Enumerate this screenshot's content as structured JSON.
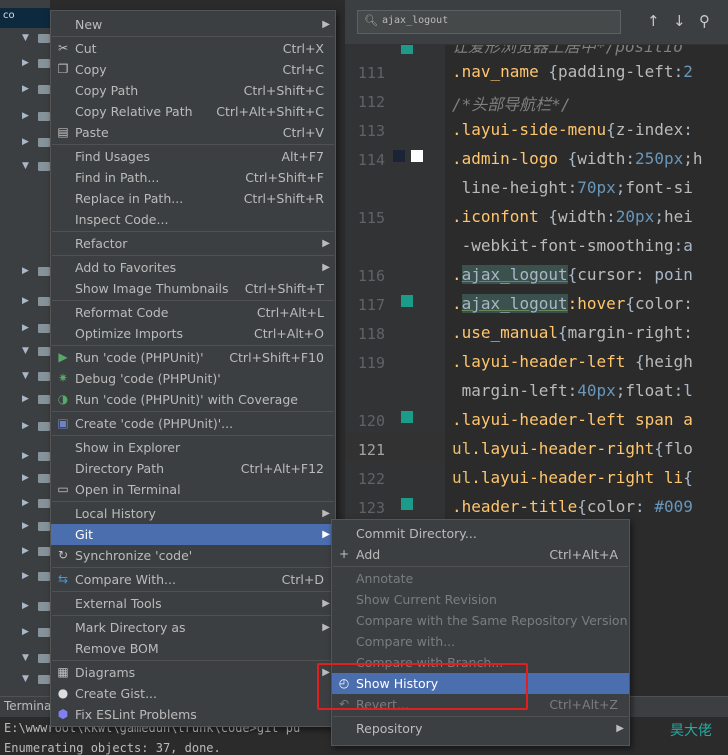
{
  "tree": {
    "root_label": "co"
  },
  "editor": {
    "search": {
      "query": "ajax_logout"
    },
    "lines": [
      {
        "num": "",
        "parts": [
          [
            "cmt",
            "让爱形浏览器上居中*/positio"
          ]
        ]
      },
      {
        "num": "111",
        "parts": [
          [
            "sel",
            ".nav_name"
          ],
          [
            "",
            " {"
          ],
          [
            "prop",
            "padding-left"
          ],
          [
            "",
            ":"
          ],
          [
            "num",
            "2"
          ]
        ]
      },
      {
        "num": "112",
        "parts": [
          [
            "cmt",
            "/*头部导航栏*/"
          ]
        ]
      },
      {
        "num": "113",
        "parts": [
          [
            "sel",
            ".layui-side-menu"
          ],
          [
            "",
            "{"
          ],
          [
            "prop",
            "z-index"
          ],
          [
            "",
            ":"
          ]
        ]
      },
      {
        "num": "114",
        "parts": [
          [
            "sel",
            ".admin-logo"
          ],
          [
            "",
            " {"
          ],
          [
            "prop",
            "width"
          ],
          [
            "",
            ":"
          ],
          [
            "num",
            "250px"
          ],
          [
            "",
            ";"
          ],
          [
            "prop",
            "h"
          ]
        ]
      },
      {
        "num": "",
        "parts": [
          [
            "prop",
            " line-height"
          ],
          [
            "",
            ":"
          ],
          [
            "num",
            "70px"
          ],
          [
            "",
            ";"
          ],
          [
            "prop",
            "font-si"
          ]
        ]
      },
      {
        "num": "115",
        "parts": [
          [
            "sel",
            ".iconfont"
          ],
          [
            "",
            " {"
          ],
          [
            "prop",
            "width"
          ],
          [
            "",
            ":"
          ],
          [
            "num",
            "20px"
          ],
          [
            "",
            ";"
          ],
          [
            "prop",
            "hei"
          ]
        ]
      },
      {
        "num": "",
        "parts": [
          [
            "prop",
            " -webkit-font-smoothing"
          ],
          [
            "",
            ":a"
          ]
        ]
      },
      {
        "num": "116",
        "parts": [
          [
            "sel",
            "."
          ],
          [
            "hl",
            "ajax_logout"
          ],
          [
            "",
            "{"
          ],
          [
            "prop",
            "cursor"
          ],
          [
            "",
            ": poin"
          ]
        ]
      },
      {
        "num": "117",
        "parts": [
          [
            "sel",
            "."
          ],
          [
            "hl",
            "ajax_logout"
          ],
          [
            "sel",
            ":hover"
          ],
          [
            "",
            "{"
          ],
          [
            "prop",
            "color"
          ],
          [
            "",
            ":"
          ]
        ]
      },
      {
        "num": "118",
        "parts": [
          [
            "sel",
            ".use_manual"
          ],
          [
            "",
            "{"
          ],
          [
            "prop",
            "margin-right"
          ],
          [
            "",
            ":"
          ]
        ]
      },
      {
        "num": "119",
        "parts": [
          [
            "sel",
            ".layui-header-left"
          ],
          [
            "",
            " {"
          ],
          [
            "prop",
            "heigh"
          ]
        ]
      },
      {
        "num": "",
        "parts": [
          [
            "prop",
            " margin-left"
          ],
          [
            "",
            ":"
          ],
          [
            "num",
            "40px"
          ],
          [
            "",
            ";"
          ],
          [
            "prop",
            "float"
          ],
          [
            "",
            ":l"
          ]
        ]
      },
      {
        "num": "120",
        "parts": [
          [
            "sel",
            ".layui-header-left span a"
          ]
        ]
      },
      {
        "num": "121",
        "parts": [
          [
            "tag",
            "ul"
          ],
          [
            "sel",
            ".layui-header-right"
          ],
          [
            "",
            "{"
          ],
          [
            "prop",
            "flo"
          ]
        ]
      },
      {
        "num": "122",
        "parts": [
          [
            "tag",
            "ul"
          ],
          [
            "sel",
            ".layui-header-right li"
          ],
          [
            "",
            "{"
          ]
        ]
      },
      {
        "num": "123",
        "parts": [
          [
            "sel",
            ".header-title"
          ],
          [
            "",
            "{"
          ],
          [
            "prop",
            "color"
          ],
          [
            "",
            ": "
          ],
          [
            "num",
            "#009"
          ]
        ]
      },
      {
        "num": "",
        "parts": [
          [
            "",
            ""
          ]
        ]
      },
      {
        "num": "",
        "parts": [
          [
            "",
            "     "
          ],
          [
            "sel",
            "min-logo,"
          ]
        ]
      },
      {
        "num": "",
        "parts": [
          [
            "",
            "     "
          ],
          [
            "prop",
            "r"
          ],
          [
            "",
            ":"
          ],
          [
            "num",
            "#1b2337"
          ]
        ]
      },
      {
        "num": "",
        "parts": [
          [
            "",
            "     "
          ],
          [
            "sel",
            "yui-side,"
          ]
        ]
      },
      {
        "num": "",
        "parts": [
          [
            "",
            "     "
          ],
          [
            "sel",
            "yui-body"
          ],
          [
            "",
            "{"
          ]
        ]
      }
    ]
  },
  "context_menu": {
    "items": [
      {
        "label": "New",
        "shortcut": "",
        "submenu": true,
        "icon": "",
        "sep_before": false
      },
      {
        "label": "Cut",
        "shortcut": "Ctrl+X",
        "submenu": false,
        "icon": "scissors-icon",
        "sep_before": true
      },
      {
        "label": "Copy",
        "shortcut": "Ctrl+C",
        "submenu": false,
        "icon": "copy-icon",
        "sep_before": false
      },
      {
        "label": "Copy Path",
        "shortcut": "Ctrl+Shift+C",
        "submenu": false,
        "icon": "",
        "sep_before": false
      },
      {
        "label": "Copy Relative Path",
        "shortcut": "Ctrl+Alt+Shift+C",
        "submenu": false,
        "icon": "",
        "sep_before": false
      },
      {
        "label": "Paste",
        "shortcut": "Ctrl+V",
        "submenu": false,
        "icon": "clipboard-icon",
        "sep_before": false
      },
      {
        "label": "Find Usages",
        "shortcut": "Alt+F7",
        "submenu": false,
        "icon": "",
        "sep_before": true
      },
      {
        "label": "Find in Path...",
        "shortcut": "Ctrl+Shift+F",
        "submenu": false,
        "icon": "",
        "sep_before": false
      },
      {
        "label": "Replace in Path...",
        "shortcut": "Ctrl+Shift+R",
        "submenu": false,
        "icon": "",
        "sep_before": false
      },
      {
        "label": "Inspect Code...",
        "shortcut": "",
        "submenu": false,
        "icon": "",
        "sep_before": false
      },
      {
        "label": "Refactor",
        "shortcut": "",
        "submenu": true,
        "icon": "",
        "sep_before": true
      },
      {
        "label": "Add to Favorites",
        "shortcut": "",
        "submenu": true,
        "icon": "",
        "sep_before": true
      },
      {
        "label": "Show Image Thumbnails",
        "shortcut": "Ctrl+Shift+T",
        "submenu": false,
        "icon": "",
        "sep_before": false
      },
      {
        "label": "Reformat Code",
        "shortcut": "Ctrl+Alt+L",
        "submenu": false,
        "icon": "",
        "sep_before": true
      },
      {
        "label": "Optimize Imports",
        "shortcut": "Ctrl+Alt+O",
        "submenu": false,
        "icon": "",
        "sep_before": false
      },
      {
        "label": "Run 'code (PHPUnit)'",
        "shortcut": "Ctrl+Shift+F10",
        "submenu": false,
        "icon": "run-icon",
        "sep_before": true
      },
      {
        "label": "Debug 'code (PHPUnit)'",
        "shortcut": "",
        "submenu": false,
        "icon": "debug-icon",
        "sep_before": false
      },
      {
        "label": "Run 'code (PHPUnit)' with Coverage",
        "shortcut": "",
        "submenu": false,
        "icon": "coverage-icon",
        "sep_before": false
      },
      {
        "label": "Create 'code (PHPUnit)'...",
        "shortcut": "",
        "submenu": false,
        "icon": "php-icon",
        "sep_before": true
      },
      {
        "label": "Show in Explorer",
        "shortcut": "",
        "submenu": false,
        "icon": "",
        "sep_before": true
      },
      {
        "label": "Directory Path",
        "shortcut": "Ctrl+Alt+F12",
        "submenu": false,
        "icon": "",
        "sep_before": false
      },
      {
        "label": "Open in Terminal",
        "shortcut": "",
        "submenu": false,
        "icon": "terminal-icon",
        "sep_before": false
      },
      {
        "label": "Local History",
        "shortcut": "",
        "submenu": true,
        "icon": "",
        "sep_before": true
      },
      {
        "label": "Git",
        "shortcut": "",
        "submenu": true,
        "icon": "",
        "sep_before": false,
        "highlighted": true
      },
      {
        "label": "Synchronize 'code'",
        "shortcut": "",
        "submenu": false,
        "icon": "sync-icon",
        "sep_before": false
      },
      {
        "label": "Compare With...",
        "shortcut": "Ctrl+D",
        "submenu": false,
        "icon": "compare-icon",
        "sep_before": true
      },
      {
        "label": "External Tools",
        "shortcut": "",
        "submenu": true,
        "icon": "",
        "sep_before": true
      },
      {
        "label": "Mark Directory as",
        "shortcut": "",
        "submenu": true,
        "icon": "",
        "sep_before": true
      },
      {
        "label": "Remove BOM",
        "shortcut": "",
        "submenu": false,
        "icon": "",
        "sep_before": false
      },
      {
        "label": "Diagrams",
        "shortcut": "",
        "submenu": true,
        "icon": "diagram-icon",
        "sep_before": true
      },
      {
        "label": "Create Gist...",
        "shortcut": "",
        "submenu": false,
        "icon": "github-icon",
        "sep_before": false
      },
      {
        "label": "Fix ESLint Problems",
        "shortcut": "",
        "submenu": false,
        "icon": "eslint-icon",
        "sep_before": false
      }
    ]
  },
  "git_submenu": {
    "items": [
      {
        "label": "Commit Directory...",
        "shortcut": "",
        "disabled": false,
        "icon": "",
        "sep_before": false
      },
      {
        "label": "Add",
        "shortcut": "Ctrl+Alt+A",
        "disabled": false,
        "icon": "plus-icon",
        "sep_before": false
      },
      {
        "label": "Annotate",
        "shortcut": "",
        "disabled": true,
        "icon": "",
        "sep_before": true
      },
      {
        "label": "Show Current Revision",
        "shortcut": "",
        "disabled": true,
        "icon": "",
        "sep_before": false
      },
      {
        "label": "Compare with the Same Repository Version",
        "shortcut": "",
        "disabled": true,
        "icon": "",
        "sep_before": false
      },
      {
        "label": "Compare with...",
        "shortcut": "",
        "disabled": true,
        "icon": "",
        "sep_before": false
      },
      {
        "label": "Compare with Branch...",
        "shortcut": "",
        "disabled": true,
        "icon": "",
        "sep_before": false
      },
      {
        "label": "Show History",
        "shortcut": "",
        "disabled": false,
        "icon": "clock-icon",
        "sep_before": false,
        "highlighted": true
      },
      {
        "label": "Revert...",
        "shortcut": "Ctrl+Alt+Z",
        "disabled": true,
        "icon": "revert-icon",
        "sep_before": false
      },
      {
        "label": "Repository",
        "shortcut": "",
        "disabled": false,
        "icon": "",
        "sep_before": true,
        "submenu": true
      }
    ]
  },
  "terminal": {
    "tab_label": "Termina",
    "line1": "E:\\wwwroot\\kkwl\\gamedun\\trunk\\code>git pu",
    "line2": "Enumerating objects: 37, done.",
    "watermark": "昊大佬"
  }
}
